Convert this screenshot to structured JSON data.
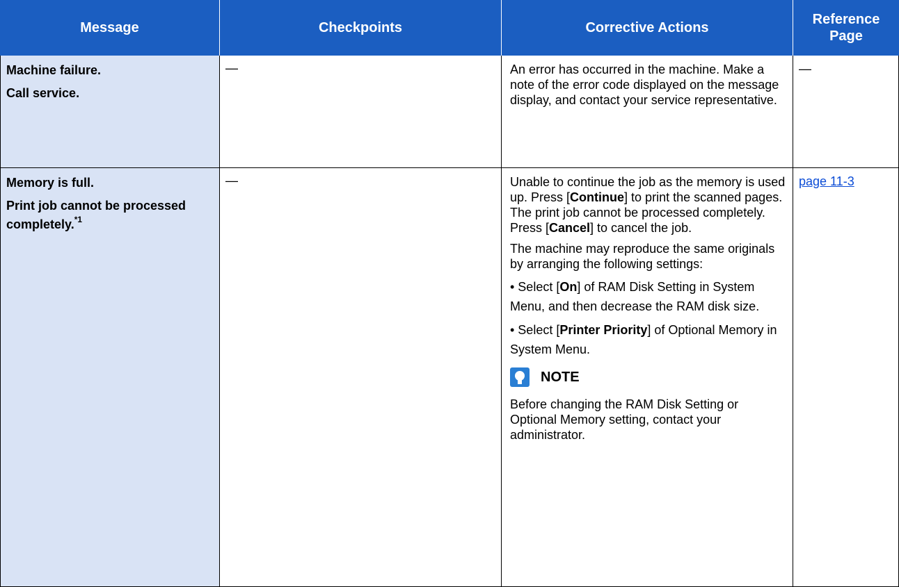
{
  "header": {
    "message": "Message",
    "checkpoints": "Checkpoints",
    "corrective": "Corrective Actions",
    "reference_line1": "Reference",
    "reference_line2": "Page"
  },
  "rows": [
    {
      "message_lines": [
        "Machine failure.",
        "Call service."
      ],
      "checkpoint": "—",
      "action": "An error has occurred in the machine. Make a note of the error code displayed on the message display, and contact your service representative.",
      "reference": "—"
    },
    {
      "message_lines": [
        "Memory is full.",
        "Print job cannot be processed completely."
      ],
      "message_footnote": "*1",
      "checkpoint": "—",
      "action_p1": {
        "t1": "Unable to continue the job as the memory is used up. Press [",
        "b1": "Continue",
        "t2": "] to print the scanned pages. The print job cannot be processed completely. Press [",
        "b2": "Cancel",
        "t3": "] to cancel the job."
      },
      "action_p2": "The machine may reproduce the same originals by arranging the following settings:",
      "bullet1": {
        "t1": "• Select [",
        "b1": "On",
        "t2": "] of RAM Disk Setting in System Menu, and then decrease the RAM disk size."
      },
      "bullet2": {
        "t1": "• Select [",
        "b1": "Printer Priority",
        "t2": "] of Optional Memory in System Menu."
      },
      "note_label": "NOTE",
      "note_text": "Before changing the RAM Disk Setting or Optional Memory setting, contact your administrator.",
      "reference": "page 11-3"
    }
  ],
  "colors": {
    "header_bg": "#1b5ec1",
    "message_bg": "#d9e3f5",
    "link": "#0b4cd6"
  }
}
